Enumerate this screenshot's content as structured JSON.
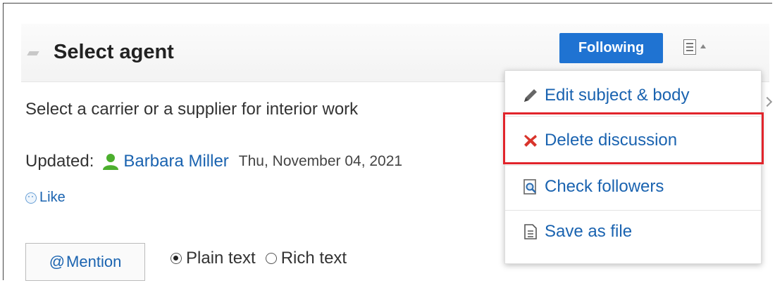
{
  "header": {
    "title": "Select agent",
    "follow_label": "Following"
  },
  "post": {
    "body": "Select a carrier or a supplier for interior work",
    "updated_label": "Updated:",
    "author": "Barbara Miller",
    "date": "Thu, November 04, 2021",
    "like_label": "Like"
  },
  "composer": {
    "mention_label": "Mention",
    "mention_at": "@",
    "plain_text_label": "Plain text",
    "rich_text_label": "Rich text",
    "selected": "Plain text"
  },
  "menu": {
    "items": [
      {
        "label": "Edit subject & body",
        "icon": "pencil-icon"
      },
      {
        "label": "Delete discussion",
        "icon": "delete-x-icon"
      },
      {
        "label": "Check followers",
        "icon": "magnifier-document-icon"
      },
      {
        "label": "Save as file",
        "icon": "document-icon"
      }
    ],
    "highlighted_index": 1
  },
  "colors": {
    "accent": "#1f73d2",
    "link": "#1a63b0",
    "highlight": "#e1242b",
    "delete_icon": "#d9342b",
    "user_icon": "#4caf2e"
  }
}
